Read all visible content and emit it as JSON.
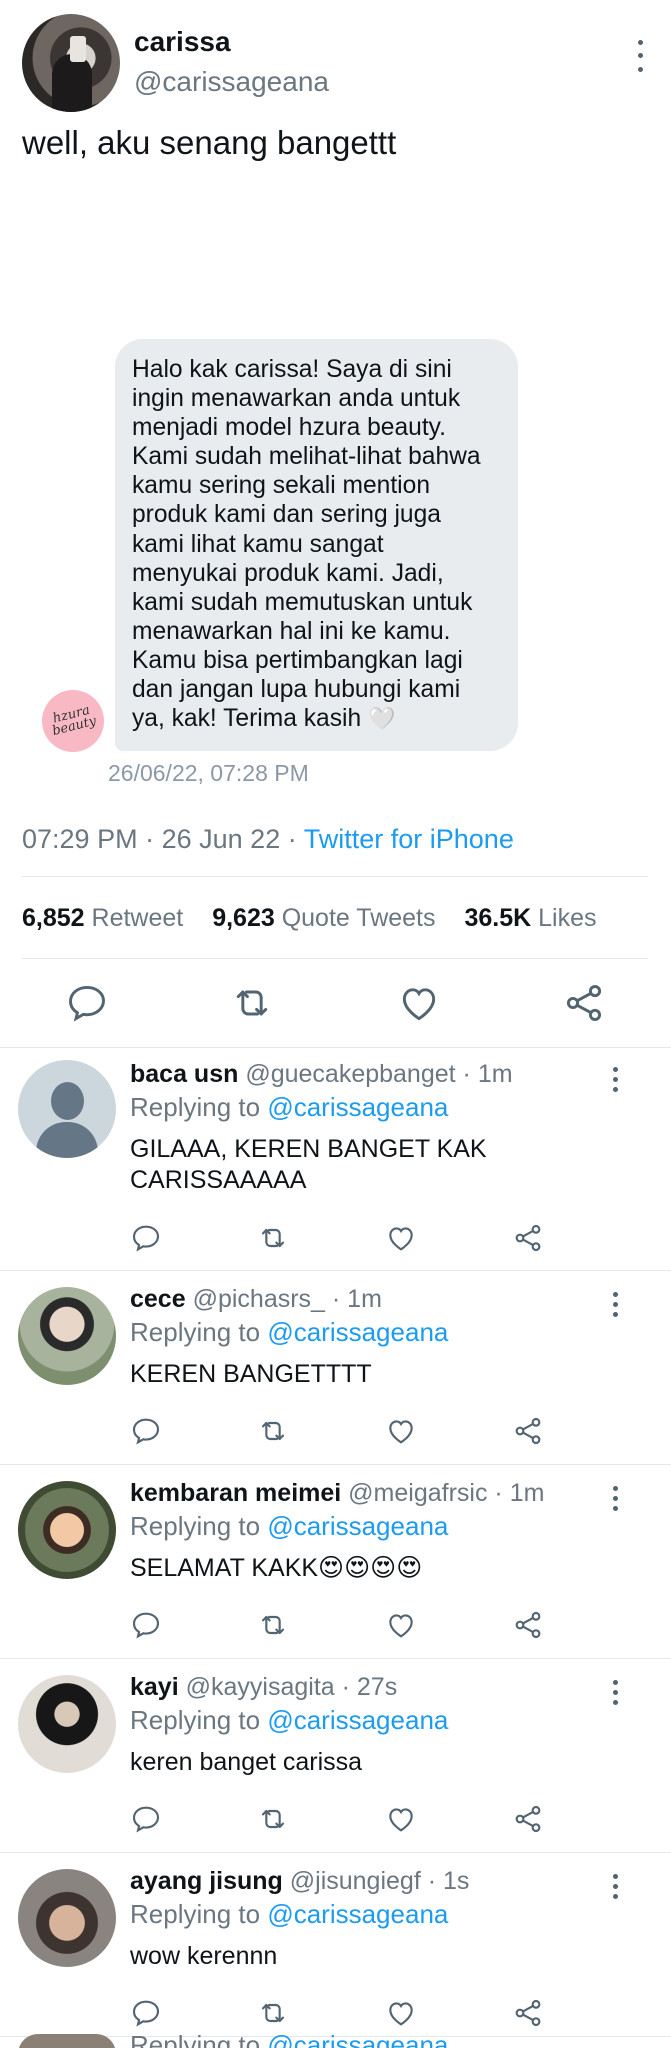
{
  "tweet": {
    "display_name": "carissa",
    "handle": "@carissageana",
    "text": "well, aku senang bangettt",
    "dm": {
      "lines": [
        "Halo kak carissa! Saya di sini",
        "ingin menawarkan anda untuk",
        "menjadi model hzura beauty.",
        "Kami sudah melihat-lihat bahwa",
        "kamu sering sekali mention",
        "produk kami dan sering juga",
        "kami lihat kamu sangat",
        "menyukai produk kami. Jadi,",
        "kami sudah memutuskan untuk",
        "menawarkan hal ini ke kamu.",
        "Kamu bisa pertimbangkan lagi",
        "dan jangan lupa hubungi kami",
        "ya, kak! Terima kasih"
      ],
      "heart_emoji": "🤍",
      "sender_avatar_text": "hzura beauty",
      "timestamp": "26/06/22, 07:28 PM"
    },
    "meta": {
      "time": "07:29 PM",
      "date": "26 Jun 22",
      "separator": "·",
      "source": "Twitter for iPhone"
    },
    "stats": {
      "retweets_count": "6,852",
      "retweets_label": "Retweet",
      "quotes_count": "9,623",
      "quotes_label": "Quote Tweets",
      "likes_count": "36.5K",
      "likes_label": "Likes"
    }
  },
  "icons": {
    "reply": "reply-icon",
    "retweet": "retweet-icon",
    "like": "heart-icon",
    "share": "share-icon",
    "more": "more-vertical-icon"
  },
  "colors": {
    "accent": "#1d9bf0",
    "muted": "#6b7780",
    "bubble": "#e8ecef",
    "icon": "#536471"
  },
  "replying_to_label": "Replying to",
  "replies": [
    {
      "name": "baca usn",
      "handle": "@guecakepbanget",
      "time": "1m",
      "mention": "@carissageana",
      "text": "GILAAA, KEREN BANGET KAK CARISSAAAAA"
    },
    {
      "name": "cece",
      "handle": "@pichasrs_",
      "time": "1m",
      "mention": "@carissageana",
      "text": "KEREN BANGETTTT"
    },
    {
      "name": "kembaran meimei",
      "handle": "@meigafrsic",
      "time": "1m",
      "mention": "@carissageana",
      "text": "SELAMAT KAKK😍😍😍😍"
    },
    {
      "name": "kayi",
      "handle": "@kayyisagita",
      "time": "27s",
      "mention": "@carissageana",
      "text": "keren banget carissa"
    },
    {
      "name": "ayang jisung",
      "handle": "@jisungiegf",
      "time": "1s",
      "mention": "@carissageana",
      "text": "wow kerennn"
    }
  ],
  "partial_reply": {
    "mention": "@carissageana"
  }
}
